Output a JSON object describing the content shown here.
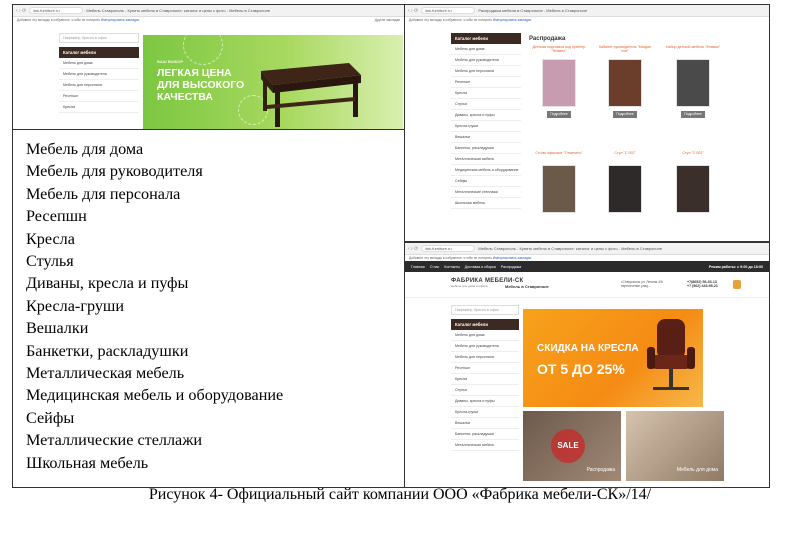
{
  "screenshot_top_left": {
    "browser": {
      "url": "fab-furniture.ru",
      "tab_title": "Мебель Ставрополь - Купить мебель в Ставрополе: каталог и цены с фото - Мебель в Ставрополе",
      "notice": "Добавьте эту вкладку в избранное, чтобы не потерять",
      "notice_link": "Импортировать закладки",
      "other_bookmarks": "Другие закладки"
    },
    "search_placeholder": "Например, Кресло в офис",
    "menu_header": "Каталог мебели",
    "menu_items": [
      "Мебель для дома",
      "Мебель для руководителя",
      "Мебель для персонала",
      "Ресепшн",
      "Кресла"
    ],
    "banner": {
      "eyebrow": "ВАШ ВЫБОР",
      "line1": "ЛЕГКАЯ ЦЕНА",
      "line2": "ДЛЯ ВЫСОКОГО",
      "line3": "КАЧЕСТВА"
    }
  },
  "screenshot_top_right": {
    "browser": {
      "url": "fab-furniture.ru",
      "tab_title": "Распродажа мебели в Ставрополе - Мебель в Ставрополе",
      "notice": "Добавьте эту вкладку в избранное, чтобы не потерять",
      "notice_link": "Импортировать закладки"
    },
    "menu_header": "Каталог мебели",
    "menu_items": [
      "Мебель для дома",
      "Мебель для руководителя",
      "Мебель для персонала",
      "Ресепшн",
      "Кресла",
      "Стулья",
      "Диваны, кресла и пуфы",
      "Кресла-груши",
      "Вешалки",
      "Банкетки, раскладушки",
      "Металлическая мебель",
      "Медицинская мебель и оборудование",
      "Сейфы",
      "Металлические стеллажи",
      "Школьная мебель"
    ],
    "page_title": "Распродажа",
    "products": [
      {
        "name": "Детская подставка под принтер \"Флавио\"",
        "button": "Подробнее",
        "color": "#c79bb0"
      },
      {
        "name": "Кабинет руководителя \"Магдан ноа\"",
        "button": "Подробнее",
        "color": "#6b3e2b"
      },
      {
        "name": "Набор детской мебели \"Флавио\"",
        "button": "Подробнее",
        "color": "#4a4a4a"
      },
      {
        "name": "Столы офисные \"Отмечено\"",
        "button": "",
        "color": "#6b5a4a"
      },
      {
        "name": "Стул \"С 002\"",
        "button": "",
        "color": "#2e2a2a"
      },
      {
        "name": "Стул \"С 002\"",
        "button": "",
        "color": "#3a2f2a"
      }
    ]
  },
  "screenshot_bottom_right": {
    "browser": {
      "url": "fab-furniture.ru",
      "tab_title": "Мебель Ставрополь - Купить мебель в Ставрополе: каталог и цены с фото - Мебель в Ставрополе",
      "notice": "Добавьте эту вкладку в избранное, чтобы не потерять",
      "notice_link": "Импортировать закладки"
    },
    "topnav": [
      "Главная",
      "О нас",
      "Контакты",
      "Доставка и сборка",
      "Распродажа"
    ],
    "hours": "Режим работы: с 9:00 до 18:00",
    "logo": "ФАБРИКА МЕБЕЛИ-СК",
    "logo_sub": "мебель для дома и офиса",
    "logo_city": "Мебель в Ставрополе",
    "address": [
      "г.Ставрополь ул. Ленина 4/8",
      "пересечение улиц..."
    ],
    "phones": [
      "+7(8652) 56-33-13",
      "+7 (962) 443-95-21"
    ],
    "search_placeholder": "Например, Кресло в офис",
    "menu_header": "Каталог мебели",
    "menu_items": [
      "Мебель для дома",
      "Мебель для руководителя",
      "Мебель для персонала",
      "Ресепшн",
      "Кресла",
      "Стулья",
      "Диваны, кресла и пуфы",
      "Кресла-груши",
      "Вешалки",
      "Банкетки, раскладушки",
      "Металлическая мебель"
    ],
    "sale_banner": {
      "line1": "СКИДКА НА КРЕСЛА",
      "line2": "ОТ 5 ДО 25%"
    },
    "tiles": [
      {
        "label": "Распродажа",
        "badge": "SALE"
      },
      {
        "label": "Мебель для дома",
        "badge": ""
      }
    ]
  },
  "category_list": [
    "Мебель для дома",
    "Мебель для руководителя",
    "Мебель для персонала",
    "Ресепшн",
    "Кресла",
    "Стулья",
    "Диваны, кресла и пуфы",
    "Кресла-груши",
    "Вешалки",
    "Банкетки, раскладушки",
    "Металлическая мебель",
    "Медицинская мебель и оборудование",
    "Сейфы",
    "Металлические стеллажи",
    "Школьная мебель"
  ],
  "caption": "Рисунок 4- Официальный сайт компании ООО «Фабрика мебели-СК»/14/"
}
